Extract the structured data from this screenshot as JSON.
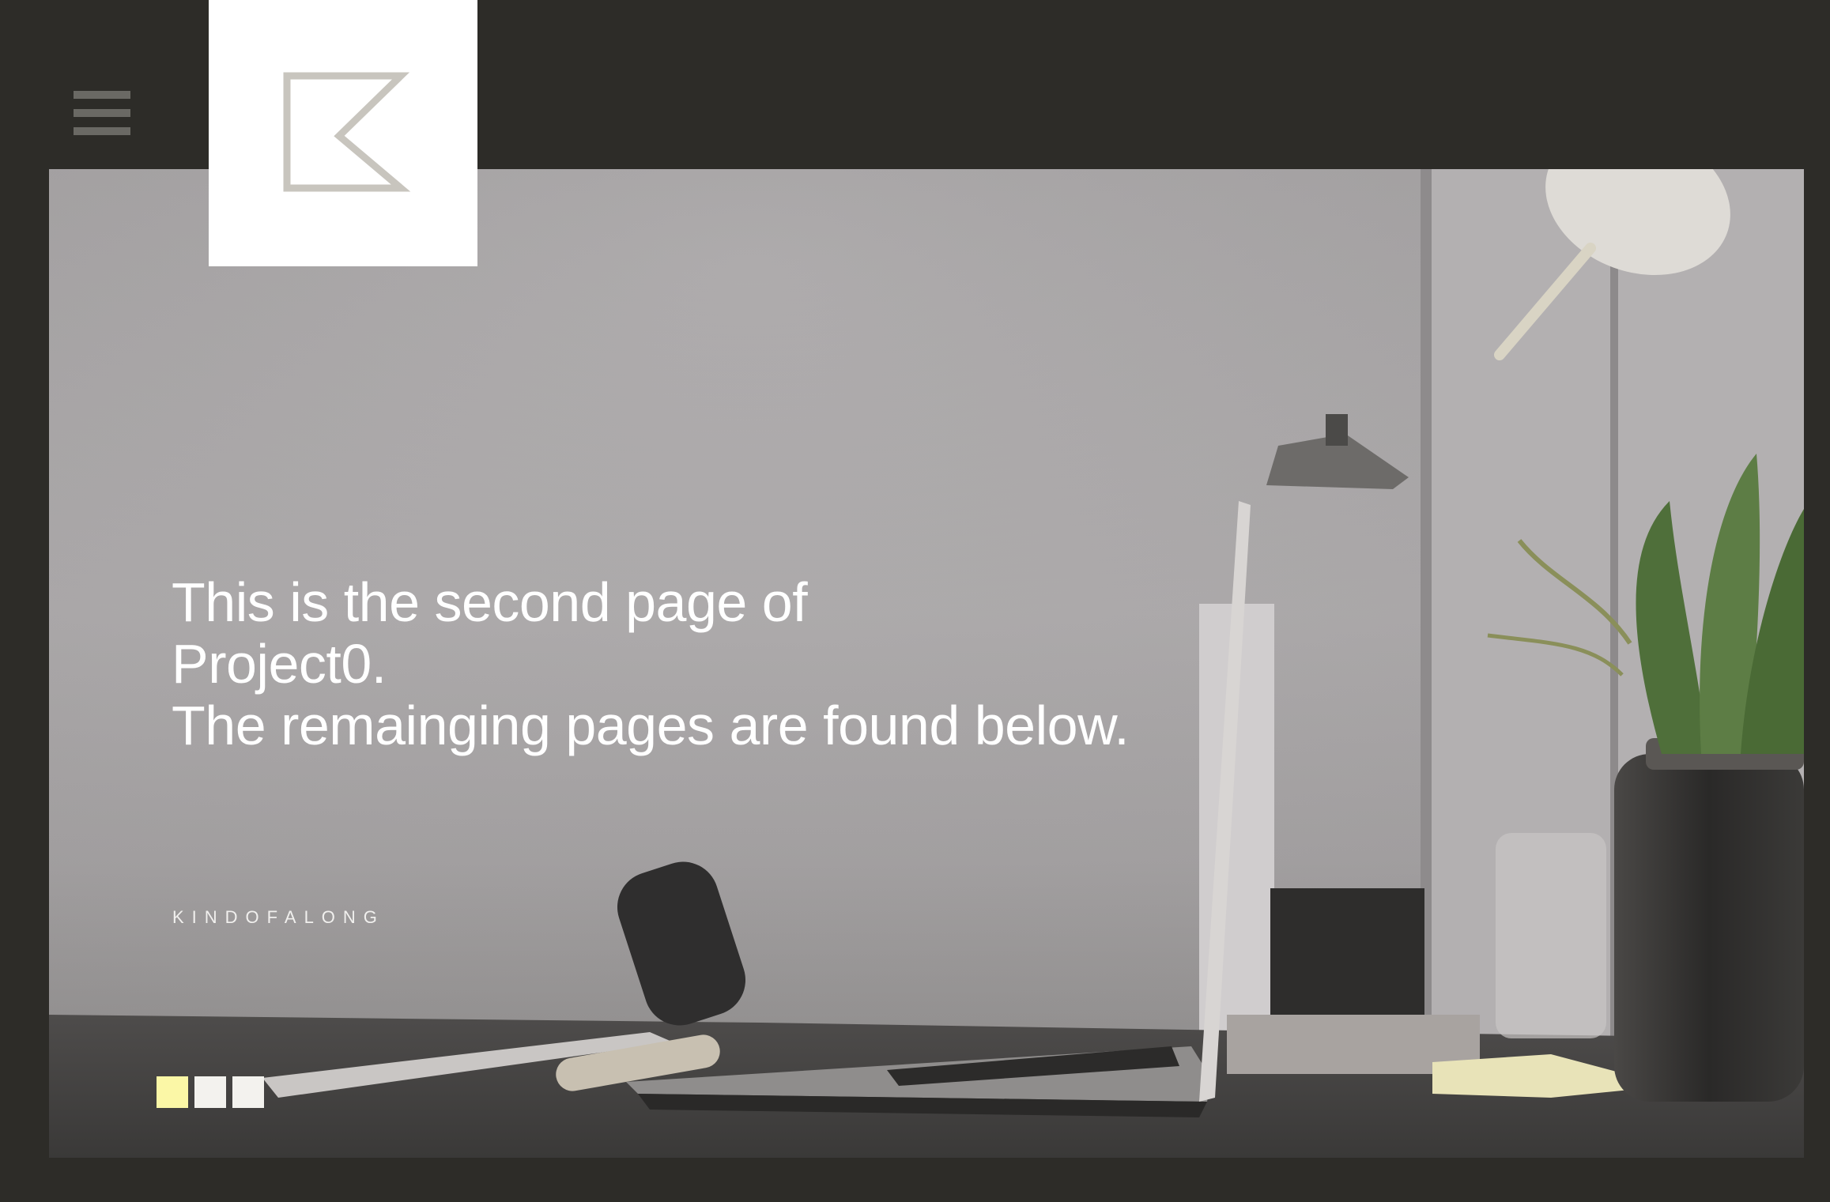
{
  "header": {
    "menu_icon": "hamburger-menu-icon",
    "logo_icon": "k-monogram-logo-icon"
  },
  "hero": {
    "headline_lines": [
      "This is the second page of",
      "Project0.",
      "The remainging pages are found below."
    ],
    "tagline": "KINDOFALONG",
    "background": "desk-with-laptop-lamp-and-plant-photo"
  },
  "pager": {
    "page_count": 3,
    "active_index": 0
  },
  "colors": {
    "page_background": "#2d2c28",
    "logo_tile": "#ffffff",
    "logo_stroke": "#c8c5be",
    "active_indicator": "#fbf7a6",
    "inactive_indicator": "#f3f2ee"
  }
}
